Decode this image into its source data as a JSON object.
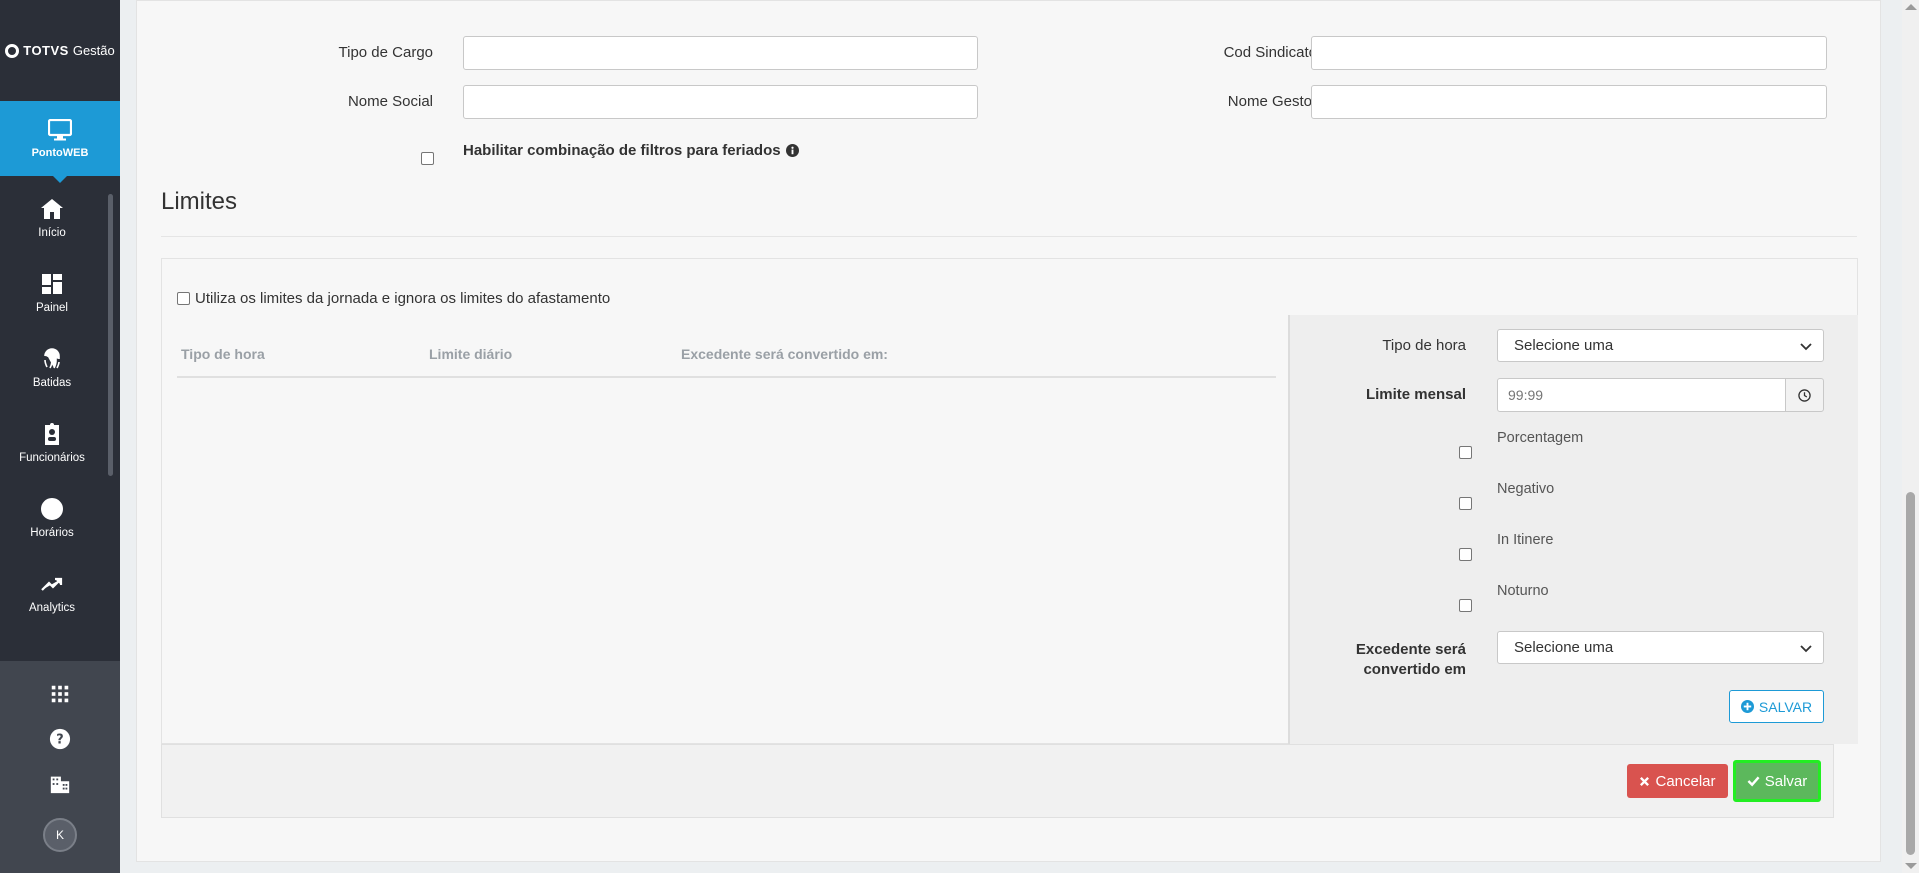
{
  "brand": {
    "name": "TOTVS",
    "product": "Gestão"
  },
  "sidebar": {
    "module": {
      "label": "PontoWEB",
      "icon": "monitor-icon"
    },
    "items": [
      {
        "label": "Início",
        "icon": "home-icon"
      },
      {
        "label": "Painel",
        "icon": "dashboard-icon"
      },
      {
        "label": "Batidas",
        "icon": "fingerprint-icon"
      },
      {
        "label": "Funcionários",
        "icon": "employee-badge-icon"
      },
      {
        "label": "Horários",
        "icon": "clock-icon"
      },
      {
        "label": "Analytics",
        "icon": "trending-up-icon"
      }
    ],
    "bottom": {
      "avatar_initial": "K",
      "icons": [
        "apps-grid-icon",
        "help-icon",
        "building-icon"
      ]
    }
  },
  "form": {
    "tipo_de_cargo": {
      "label": "Tipo de Cargo",
      "value": ""
    },
    "cod_sindicato": {
      "label": "Cod Sindicato",
      "value": ""
    },
    "nome_social": {
      "label": "Nome Social",
      "value": ""
    },
    "nome_gestor": {
      "label": "Nome Gestor",
      "value": ""
    },
    "feriados_checkbox_label": "Habilitar combinação de filtros para feriados"
  },
  "limites": {
    "title": "Limites",
    "ignore_checkbox_label": "Utiliza os limites da jornada e ignora os limites do afastamento",
    "table_headers": [
      "Tipo de hora",
      "Limite diário",
      "Excedente será convertido em:"
    ],
    "table_rows": [],
    "editor": {
      "tipo_hora_label": "Tipo de hora",
      "tipo_hora_value": "Selecione uma",
      "limite_mensal_label": "Limite mensal",
      "limite_mensal_placeholder": "99:99",
      "checkboxes": [
        "Porcentagem",
        "Negativo",
        "In Itinere",
        "Noturno"
      ],
      "excedente_label_line1": "Excedente será",
      "excedente_label_line2": "convertido em",
      "excedente_value": "Selecione uma",
      "save_label": "SALVAR"
    }
  },
  "footer": {
    "cancel_label": "Cancelar",
    "save_label": "Salvar"
  },
  "colors": {
    "sidebar_bg": "#2b2f38",
    "accent": "#1d9ad6",
    "cancel": "#d9534f",
    "save": "#5cb85c",
    "save_highlight": "#22ee22"
  }
}
